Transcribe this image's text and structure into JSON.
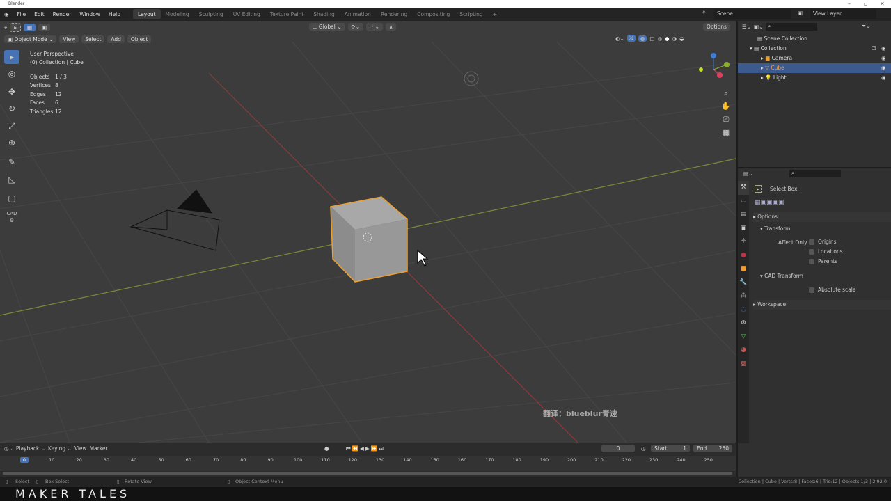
{
  "window": {
    "title": "Blender"
  },
  "menu": [
    "File",
    "Edit",
    "Render",
    "Window",
    "Help"
  ],
  "workspaces": [
    "Layout",
    "Modeling",
    "Sculpting",
    "UV Editing",
    "Texture Paint",
    "Shading",
    "Animation",
    "Rendering",
    "Compositing",
    "Scripting",
    "+"
  ],
  "scene": {
    "scene_name": "Scene",
    "view_layer": "View Layer"
  },
  "viewport": {
    "mode": "Object Mode",
    "menus": [
      "View",
      "Select",
      "Add",
      "Object"
    ],
    "orientation": "Global",
    "options": "Options",
    "perspective": "User Perspective",
    "collection": "(0) Collection | Cube",
    "stats": [
      {
        "label": "Objects",
        "value": "1 / 3"
      },
      {
        "label": "Vertices",
        "value": "8"
      },
      {
        "label": "Edges",
        "value": "12"
      },
      {
        "label": "Faces",
        "value": "6"
      },
      {
        "label": "Triangles",
        "value": "12"
      }
    ],
    "watermark": "翻译：blueblur青速",
    "gizmo": {
      "z": "Z",
      "y": "Y",
      "x": "X"
    }
  },
  "outliner": {
    "root": "Scene Collection",
    "collection": "Collection",
    "items": [
      {
        "name": "Camera",
        "selected": false
      },
      {
        "name": "Cube",
        "selected": true
      },
      {
        "name": "Light",
        "selected": false
      }
    ]
  },
  "properties": {
    "tool": "Select Box",
    "options": "Options",
    "transform": "Transform",
    "affect_only": "Affect Only",
    "checks": [
      "Origins",
      "Locations",
      "Parents"
    ],
    "cad": "CAD Transform",
    "absolute_scale": "Absolute scale",
    "workspace": "Workspace"
  },
  "timeline": {
    "menus": [
      "Playback",
      "Keying",
      "View",
      "Marker"
    ],
    "current_frame": "0",
    "start_label": "Start",
    "start": "1",
    "end_label": "End",
    "end": "250",
    "ticks": [
      "0",
      "10",
      "20",
      "30",
      "40",
      "50",
      "60",
      "70",
      "80",
      "90",
      "100",
      "110",
      "120",
      "130",
      "140",
      "150",
      "160",
      "170",
      "180",
      "190",
      "200",
      "210",
      "220",
      "230",
      "240",
      "250"
    ]
  },
  "status": {
    "select": "Select",
    "box_select": "Box Select",
    "rotate": "Rotate View",
    "context": "Object Context Menu",
    "info": "Collection | Cube | Verts:8 | Faces:6 | Tris:12 | Objects:1/3 | 2.92.0"
  },
  "banner": "MAKER TALES"
}
